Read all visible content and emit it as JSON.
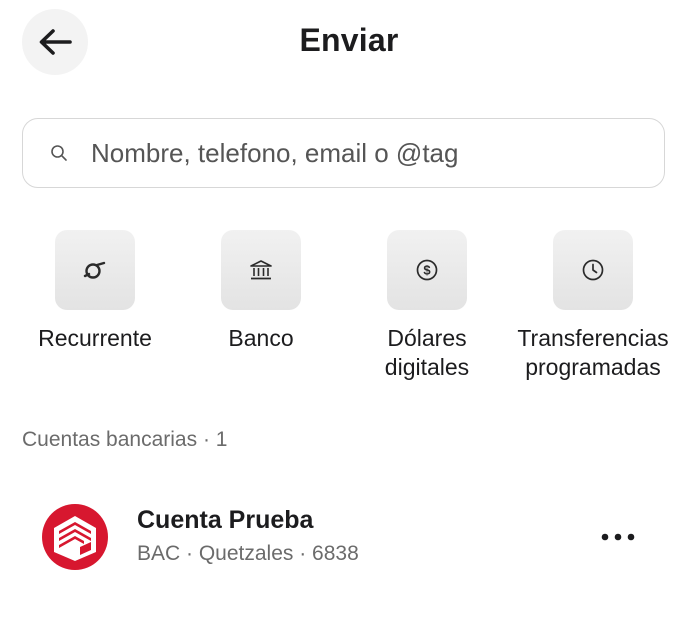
{
  "header": {
    "title": "Enviar",
    "back_icon": "arrow-left-icon"
  },
  "search": {
    "placeholder": "Nombre, telefono, email o @tag",
    "icon": "search-icon"
  },
  "actions": [
    {
      "label": "Recurrente",
      "icon": "recurring-icon"
    },
    {
      "label": "Banco",
      "icon": "bank-icon"
    },
    {
      "label": "Dólares\ndigitales",
      "icon": "dollar-coin-icon"
    },
    {
      "label": "Transferencias\nprogramadas",
      "icon": "clock-icon"
    }
  ],
  "section": {
    "title": "Cuentas bancarias · 1"
  },
  "accounts": [
    {
      "name": "Cuenta Prueba",
      "details": "BAC · Quetzales · 6838",
      "logo": "bac-logo",
      "more_icon": "more-horizontal-icon"
    }
  ],
  "colors": {
    "logo_red": "#d7172f",
    "tile_bg": "#e9e9e9",
    "secondary_text": "#6b6b6b"
  }
}
